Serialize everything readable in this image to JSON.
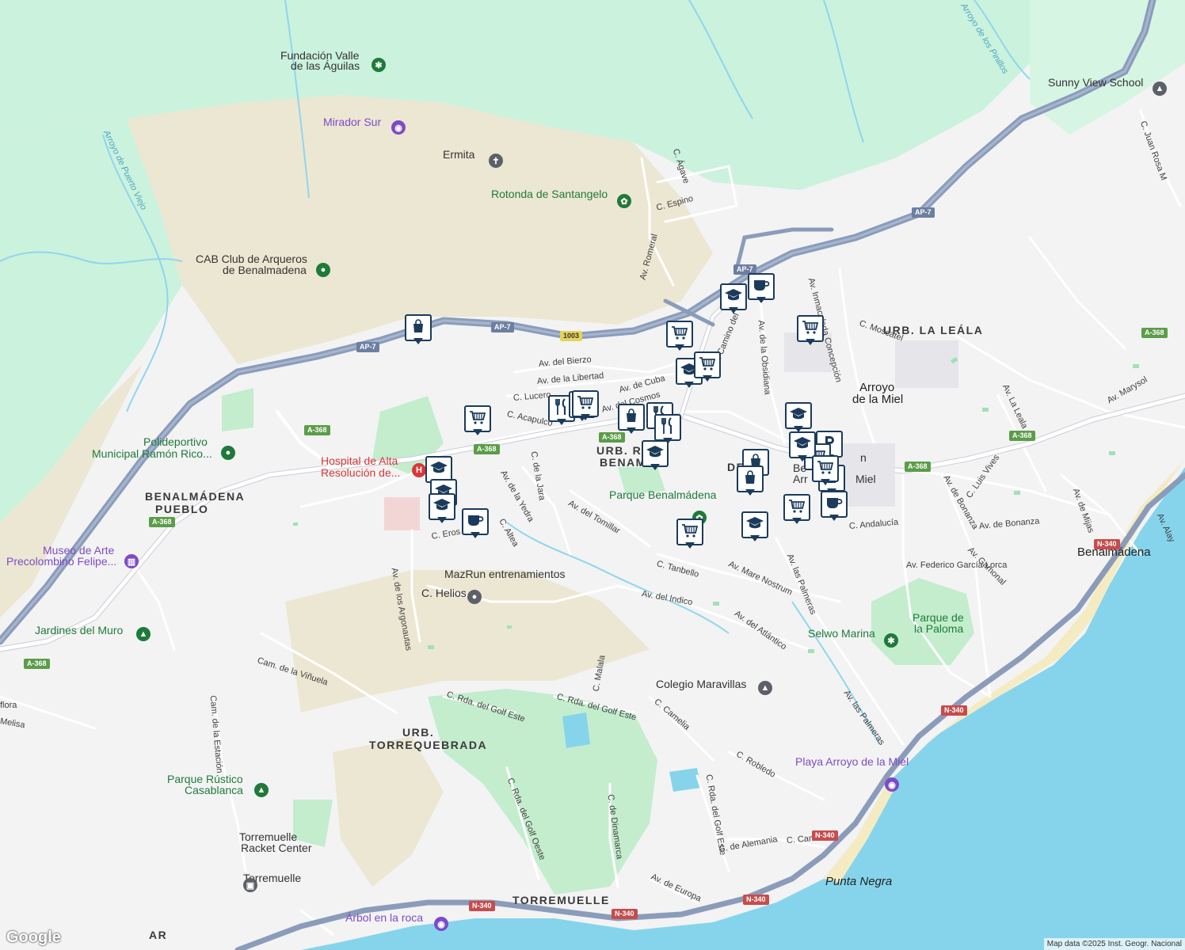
{
  "map": {
    "colors": {
      "land": "#f3f3f4",
      "forest": "#cbf2dc",
      "scrub": "#ece7d2",
      "park": "#c3edcd",
      "sea": "#86d4ec",
      "beach": "#f5ebc2",
      "motorway": "#8b9cba",
      "road": "#ffffff",
      "water_line": "#8fd6ee",
      "marker_border": "#1a3b5c",
      "poi_purple": "#7d4bc7",
      "poi_green": "#1f7a3a",
      "poi_gray": "#5d6069",
      "poi_red": "#d93838"
    },
    "water_labels": [
      {
        "text": "Arroyo de Puerto Viejo"
      },
      {
        "text": "Arroyo de los Pinillos"
      }
    ],
    "area_labels": [
      {
        "text": "BENALMÁDENA"
      },
      {
        "text": "PUEBLO"
      },
      {
        "text": "URB. LA LEÁLA"
      },
      {
        "text": "URB. RE..."
      },
      {
        "text": "BENAM..."
      },
      {
        "text": "URB."
      },
      {
        "text": "TORREQUEBRADA"
      },
      {
        "text": "TORREMUELLE"
      },
      {
        "text": "AR"
      },
      {
        "text": "DE"
      }
    ],
    "towns": [
      {
        "text": "Arroyo"
      },
      {
        "text": "de la Miel"
      },
      {
        "text": "Benalmádena"
      },
      {
        "text": "Punta Negra"
      }
    ],
    "pois": [
      {
        "text": "Fundación Valle",
        "icon": "paw-icon"
      },
      {
        "text": "de las Águilas"
      },
      {
        "text": "Mirador Sur",
        "icon": "camera-icon"
      },
      {
        "text": "Ermita",
        "icon": "cross-icon"
      },
      {
        "text": "Rotonda de Santangelo",
        "icon": "flower-icon"
      },
      {
        "text": "CAB Club de Arqueros",
        "icon": "sport-icon"
      },
      {
        "text": "de Benalmadena"
      },
      {
        "text": "Polideportivo",
        "icon": "sport-icon"
      },
      {
        "text": "Municipal Ramón Rico..."
      },
      {
        "text": "Hospital de Alta",
        "icon": "hospital-icon"
      },
      {
        "text": "Resolución de..."
      },
      {
        "text": "Museo de Arte",
        "icon": "museum-icon"
      },
      {
        "text": "Precolombino Felipe..."
      },
      {
        "text": "Jardines del Muro",
        "icon": "tree-icon"
      },
      {
        "text": "Parque Benalmádena",
        "icon": "flower-icon"
      },
      {
        "text": "MazRun entrenamientos"
      },
      {
        "text": "C. Helios",
        "icon": "sport-icon"
      },
      {
        "text": "Selwo Marina",
        "icon": "paw-icon"
      },
      {
        "text": "Parque de"
      },
      {
        "text": "la Paloma"
      },
      {
        "text": "Colegio Maravillas",
        "icon": "school-icon"
      },
      {
        "text": "Sunny View School",
        "icon": "school-icon"
      },
      {
        "text": "Playa Arroyo de la Miel",
        "icon": "camera-icon"
      },
      {
        "text": "Parque Rústico",
        "icon": "tree-icon"
      },
      {
        "text": "Casablanca"
      },
      {
        "text": "Torremuelle",
        "icon": "sport-icon"
      },
      {
        "text": "Racket Center"
      },
      {
        "text": "Torremuelle",
        "icon": "train-icon"
      },
      {
        "text": "Árbol en la roca",
        "icon": "camera-icon"
      },
      {
        "text": "Be"
      },
      {
        "text": "Arr"
      },
      {
        "text": "Miel"
      },
      {
        "text": "n"
      }
    ],
    "streets": [
      {
        "text": "C. Ágave"
      },
      {
        "text": "C. Espino"
      },
      {
        "text": "Av. Romeral"
      },
      {
        "text": "Av. del Bierzo"
      },
      {
        "text": "Av. de la Libertad"
      },
      {
        "text": "Av. de Cuba"
      },
      {
        "text": "C. Lucero"
      },
      {
        "text": "Av. del Cosmos"
      },
      {
        "text": "C. Acapulco"
      },
      {
        "text": "C. de la Jara"
      },
      {
        "text": "Av. de la Yedra"
      },
      {
        "text": "C. Altea"
      },
      {
        "text": "C. Eros"
      },
      {
        "text": "Av. del Tomillar"
      },
      {
        "text": "Av. de los Argonautas"
      },
      {
        "text": "Cam. de la Viñuela"
      },
      {
        "text": "Cam. de la Estación"
      },
      {
        "text": "C. Rda. del Golf Este"
      },
      {
        "text": "C. Rda. del Golf Este"
      },
      {
        "text": "C. Rda. del Golf Oeste"
      },
      {
        "text": "C. Malala"
      },
      {
        "text": "C. Camelia"
      },
      {
        "text": "C. de Dinamarca"
      },
      {
        "text": "C. Rda. del Golf Este"
      },
      {
        "text": "C. Robledo"
      },
      {
        "text": "C. de Alemania"
      },
      {
        "text": "C. Camelia"
      },
      {
        "text": "Av. de Europa"
      },
      {
        "text": "C. Tanbello"
      },
      {
        "text": "Av. Mare Nostrum"
      },
      {
        "text": "Av. del Indico"
      },
      {
        "text": "Av. del Atlántico"
      },
      {
        "text": "Av. las Palmeras"
      },
      {
        "text": "Av. las Palmeras"
      },
      {
        "text": "C. Andalucía"
      },
      {
        "text": "Av. Federico García Lorca"
      },
      {
        "text": "Av. de Bonanza"
      },
      {
        "text": "Av. de Bonanza"
      },
      {
        "text": "Av. Gamonal"
      },
      {
        "text": "C. Luis Vives"
      },
      {
        "text": "Av. de Mijas"
      },
      {
        "text": "Av. Alay"
      },
      {
        "text": "Av. Marysol"
      },
      {
        "text": "Av. La Leala"
      },
      {
        "text": "Av. Inmaculada Concepción"
      },
      {
        "text": "C. Moscatel"
      },
      {
        "text": "Av. de la Obsidiana"
      },
      {
        "text": "Av. Camino del Viejo"
      },
      {
        "text": "C. Juan Rosa M"
      },
      {
        "text": "flora"
      },
      {
        "text": "Melisa"
      }
    ],
    "shields": [
      {
        "text": "AP-7",
        "kind": "blue"
      },
      {
        "text": "AP-7",
        "kind": "blue"
      },
      {
        "text": "AP-7",
        "kind": "blue"
      },
      {
        "text": "AP-7",
        "kind": "blue"
      },
      {
        "text": "1003",
        "kind": "yellow"
      },
      {
        "text": "A-368",
        "kind": "green"
      },
      {
        "text": "A-368",
        "kind": "green"
      },
      {
        "text": "A-368",
        "kind": "green"
      },
      {
        "text": "A-368",
        "kind": "green"
      },
      {
        "text": "A-368",
        "kind": "green"
      },
      {
        "text": "A-368",
        "kind": "green"
      },
      {
        "text": "A-368",
        "kind": "green"
      },
      {
        "text": "A-368",
        "kind": "green"
      },
      {
        "text": "N-340",
        "kind": "red"
      },
      {
        "text": "N-340",
        "kind": "red"
      },
      {
        "text": "N-340",
        "kind": "red"
      },
      {
        "text": "N-340",
        "kind": "red"
      },
      {
        "text": "N-340",
        "kind": "red"
      },
      {
        "text": "N-340",
        "kind": "red"
      }
    ],
    "markers": [
      {
        "icon": "bag-icon"
      },
      {
        "icon": "cart-icon"
      },
      {
        "icon": "fork-knife-icon"
      },
      {
        "icon": "fork-knife-icon"
      },
      {
        "icon": "cart-icon"
      },
      {
        "icon": "bag-icon"
      },
      {
        "icon": "fork-knife-icon"
      },
      {
        "icon": "fork-knife-icon"
      },
      {
        "icon": "school-icon"
      },
      {
        "icon": "cart-icon"
      },
      {
        "icon": "school-icon"
      },
      {
        "icon": "cart-icon"
      },
      {
        "icon": "school-icon"
      },
      {
        "icon": "coffee-icon"
      },
      {
        "icon": "cart-icon"
      },
      {
        "icon": "school-icon"
      },
      {
        "icon": "school-icon"
      },
      {
        "icon": "school-icon"
      },
      {
        "icon": "coffee-icon"
      },
      {
        "icon": "cart-icon"
      },
      {
        "icon": "school-icon"
      },
      {
        "icon": "bag-icon"
      },
      {
        "icon": "bag-icon"
      },
      {
        "icon": "school-icon"
      },
      {
        "icon": "cart-icon"
      },
      {
        "icon": "parking-icon"
      },
      {
        "icon": "bag-icon"
      },
      {
        "icon": "cart-icon"
      },
      {
        "icon": "coffee-icon"
      },
      {
        "icon": "school-icon"
      },
      {
        "icon": "cart-icon"
      }
    ],
    "attribution": "Map data ©2025 Inst. Geogr. Nacional",
    "logo": "Google"
  }
}
